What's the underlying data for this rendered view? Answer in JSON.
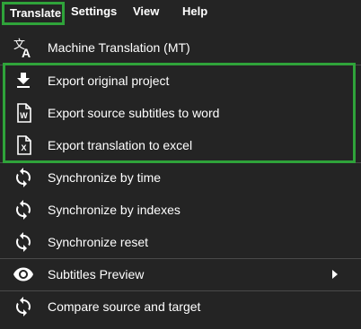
{
  "menubar": {
    "translate": "Translate",
    "settings": "Settings",
    "view": "View",
    "help": "Help"
  },
  "menu": {
    "items": [
      {
        "label": "Machine Translation (MT)",
        "icon": "translate-icon"
      },
      {
        "label": "Export original project",
        "icon": "download-icon"
      },
      {
        "label": "Export source subtitles to word",
        "icon": "word-file-icon"
      },
      {
        "label": "Export translation to excel",
        "icon": "excel-file-icon"
      },
      {
        "label": "Synchronize by time",
        "icon": "sync-icon"
      },
      {
        "label": "Synchronize by indexes",
        "icon": "sync-icon"
      },
      {
        "label": "Synchronize reset",
        "icon": "sync-icon"
      },
      {
        "label": "Subtitles Preview",
        "icon": "eye-icon",
        "has_submenu": true
      },
      {
        "label": "Compare source and target",
        "icon": "sync-icon"
      }
    ]
  },
  "colors": {
    "background": "#242424",
    "highlight": "#2fa33a",
    "divider": "#4a4a4a",
    "text": "#ffffff"
  }
}
